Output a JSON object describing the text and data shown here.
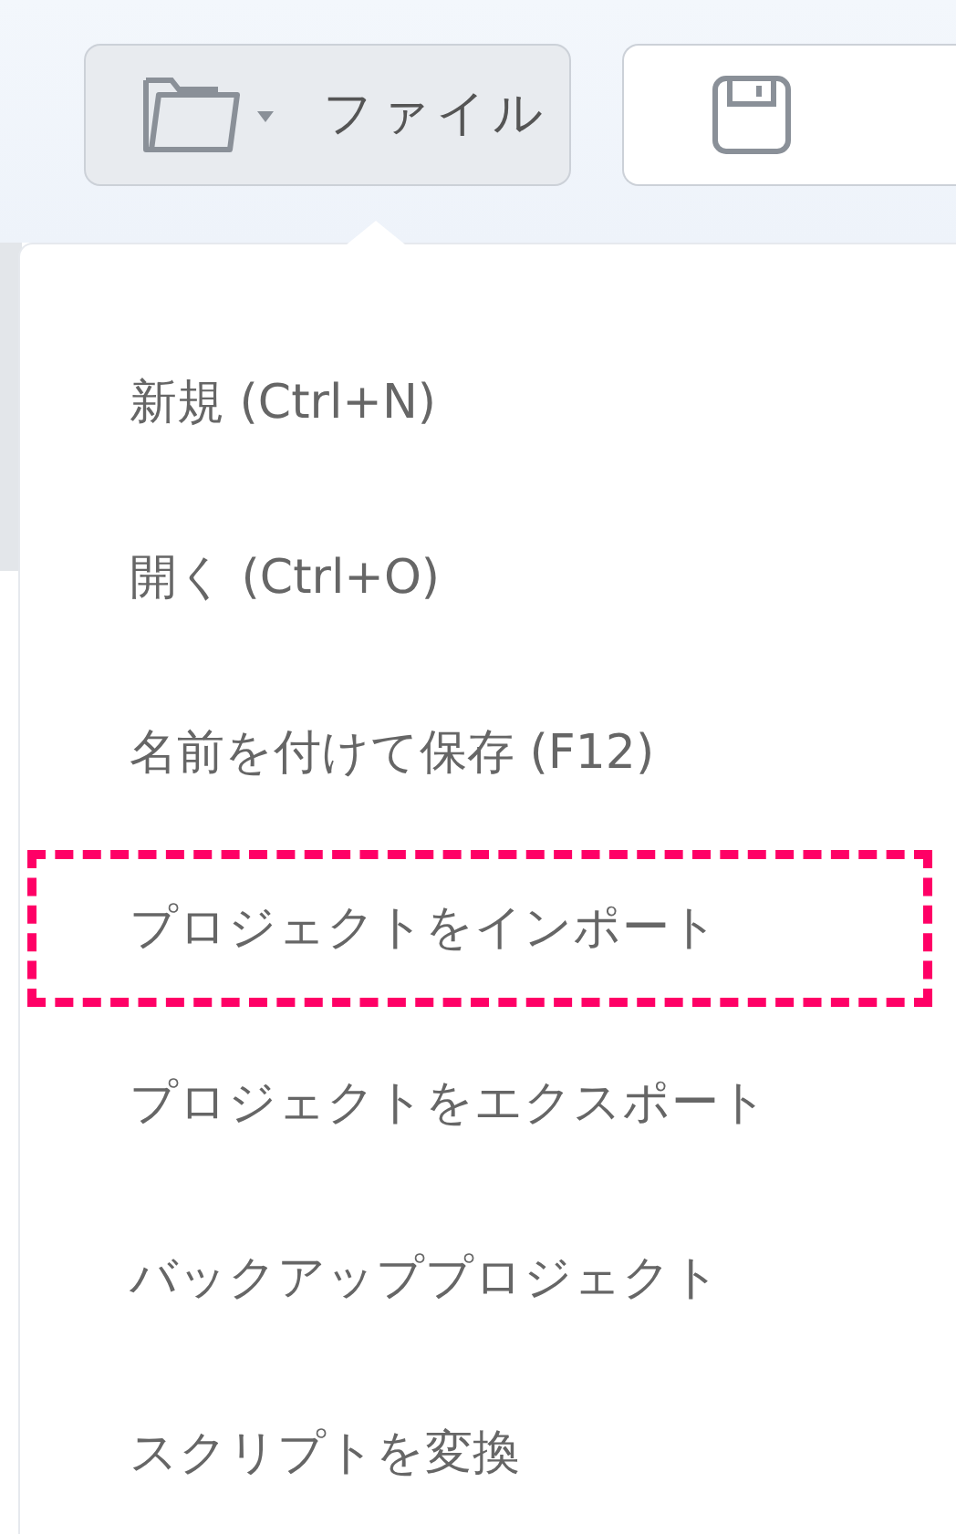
{
  "toolbar": {
    "file_button": {
      "label": "ファイル",
      "expanded": true
    }
  },
  "file_menu": [
    {
      "label": "新規 (Ctrl+N)",
      "highlighted": false
    },
    {
      "label": "開く (Ctrl+O)",
      "highlighted": false
    },
    {
      "label": "名前を付けて保存 (F12)",
      "highlighted": false
    },
    {
      "label": "プロジェクトをインポート",
      "highlighted": true
    },
    {
      "label": "プロジェクトをエクスポート",
      "highlighted": false
    },
    {
      "label": "バックアッププロジェクト",
      "highlighted": false
    },
    {
      "label": "スクリプトを変換",
      "highlighted": false
    }
  ]
}
